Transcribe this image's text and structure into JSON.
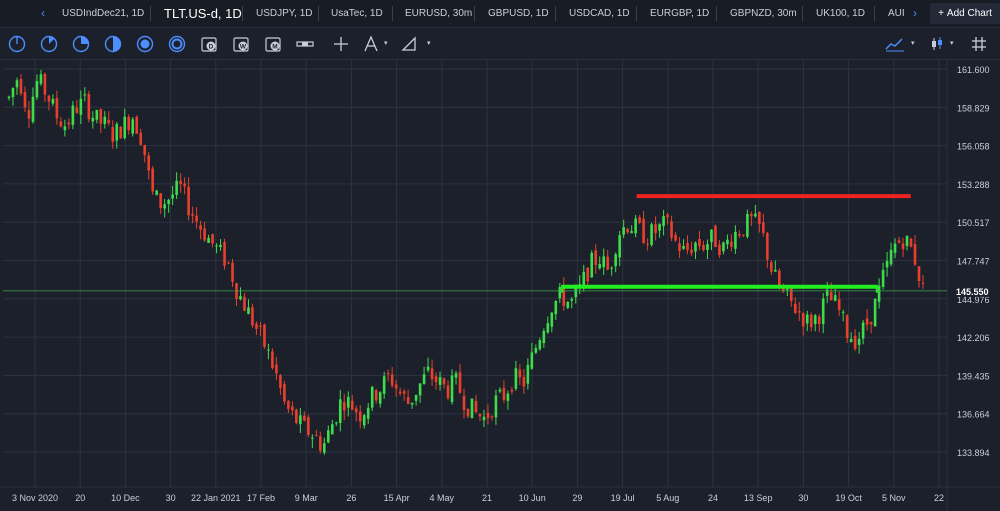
{
  "tabs": [
    {
      "label": "USDIndDec21, 1D",
      "active": false
    },
    {
      "label": "TLT.US-d, 1D",
      "active": true
    },
    {
      "label": "USDJPY, 1D",
      "active": false
    },
    {
      "label": "UsaTec, 1D",
      "active": false
    },
    {
      "label": "EURUSD, 30m",
      "active": false
    },
    {
      "label": "GBPUSD, 1D",
      "active": false
    },
    {
      "label": "USDCAD, 1D",
      "active": false
    },
    {
      "label": "EURGBP, 1D",
      "active": false
    },
    {
      "label": "GBPNZD, 30m",
      "active": false
    },
    {
      "label": "UK100, 1D",
      "active": false
    },
    {
      "label": "AUI",
      "active": false
    }
  ],
  "nav": {
    "prev": "‹",
    "next": "›"
  },
  "add_chart": {
    "plus": "+",
    "label": "Add Chart"
  },
  "toolbar": {
    "icons": [
      "circle-half-icon",
      "circle-quarter-icon",
      "circle-pie-icon",
      "circle-half-fill-icon",
      "circle-stack-icon",
      "circle-ring-icon",
      "day-icon",
      "week-icon",
      "month-icon",
      "range-bar-icon",
      "crosshair-icon",
      "draw-tool-icon",
      "ruler-icon"
    ],
    "day_letter": "D",
    "week_letter": "W",
    "month_letter": "M"
  },
  "colors": {
    "up": "#3ddc4b",
    "down": "#e8402c",
    "grid": "#2c3240",
    "bg": "#1c202b",
    "current_line": "#3aa84a",
    "support": "#22ee22",
    "resistance": "#ee2222",
    "accent": "#4a8eff"
  },
  "chart_data": {
    "type": "candlestick",
    "symbol": "TLT.US-d",
    "timeframe": "1D",
    "y_ticks": [
      "161.600",
      "158.829",
      "156.058",
      "153.288",
      "150.517",
      "147.747",
      "144.976",
      "142.206",
      "139.435",
      "136.664",
      "133.894"
    ],
    "y_tick_values": [
      161.6,
      158.829,
      156.058,
      153.288,
      150.517,
      147.747,
      144.976,
      142.206,
      139.435,
      136.664,
      133.894
    ],
    "ylim": [
      133.0,
      162.4
    ],
    "x_ticks": [
      "3 Nov 2020",
      "20",
      "10 Dec",
      "30",
      "22 Jan 2021",
      "17 Feb",
      "9 Mar",
      "26",
      "15 Apr",
      "4 May",
      "21",
      "10 Jun",
      "29",
      "19 Jul",
      "5 Aug",
      "24",
      "13 Sep",
      "30",
      "19 Oct",
      "5 Nov",
      "22"
    ],
    "current_price": "145.550",
    "current_price_value": 145.55,
    "resistance": {
      "price": 152.4,
      "from": "19 Jul",
      "to": "5 Nov"
    },
    "support": {
      "price": 145.85,
      "from": "10 Jun",
      "to": "5 Nov"
    },
    "price_path": [
      159.5,
      161.2,
      158.5,
      160.8,
      159.8,
      158.2,
      157.5,
      158.8,
      159.2,
      158.0,
      157.6,
      156.8,
      157.5,
      158.2,
      156.5,
      152.6,
      151.8,
      152.4,
      153.0,
      151.5,
      150.3,
      149.3,
      148.4,
      147.6,
      145.5,
      144.2,
      142.8,
      141.4,
      139.6,
      137.2,
      136.3,
      135.6,
      135.1,
      134.3,
      136.0,
      137.8,
      137.3,
      136.6,
      137.8,
      138.5,
      139.4,
      138.2,
      137.4,
      138.6,
      139.6,
      139.0,
      138.4,
      138.9,
      137.4,
      136.7,
      136.3,
      137.5,
      138.0,
      139.3,
      138.8,
      140.8,
      142.9,
      144.5,
      145.2,
      144.6,
      145.7,
      147.4,
      148.0,
      146.9,
      149.8,
      150.4,
      150.0,
      149.5,
      149.9,
      150.4,
      149.1,
      148.3,
      149.0,
      148.9,
      149.4,
      148.6,
      149.6,
      150.1,
      150.6,
      150.0,
      147.3,
      145.5,
      144.8,
      144.0,
      143.2,
      143.8,
      145.1,
      144.4,
      142.6,
      142.0,
      143.0,
      144.6,
      146.9,
      148.8,
      149.4,
      148.3,
      145.6
    ]
  }
}
